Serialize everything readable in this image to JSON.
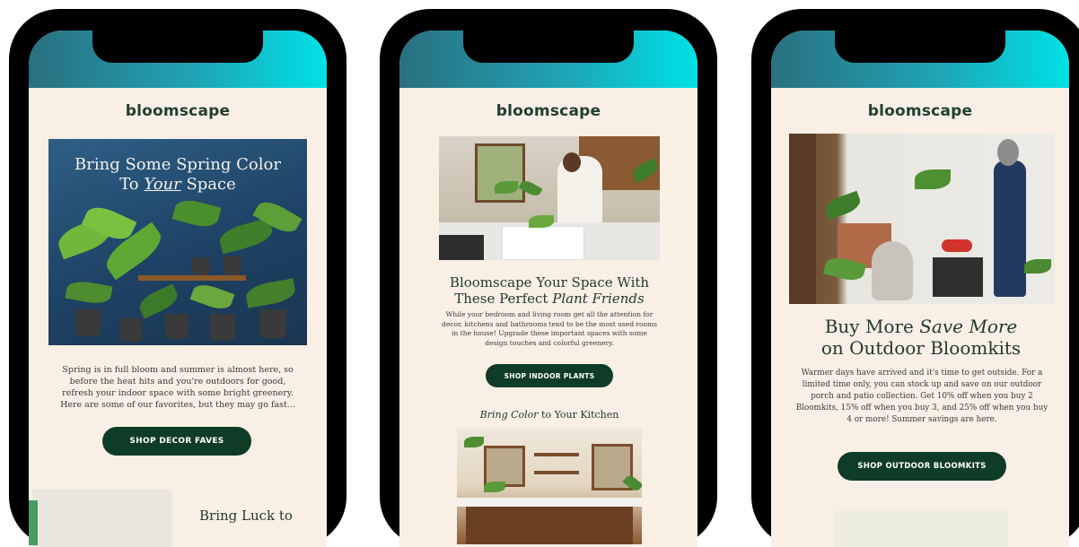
{
  "phone1": {
    "brand": "bloomscape",
    "hero_title_1": "Bring Some Spring Color",
    "hero_title_2a": "To ",
    "hero_title_2b": "Your",
    "hero_title_2c": " Space",
    "body": "Spring is in full bloom and summer is almost here, so before the heat hits and you're outdoors for good, refresh your indoor space with some bright greenery. Here are some of our favorites, but they may go fast...",
    "button": "SHOP DECOR FAVES",
    "next_heading": "Bring Luck to"
  },
  "phone2": {
    "brand": "bloomscape",
    "heading_1": "Bloomscape Your Space With",
    "heading_2a": "These Perfect ",
    "heading_2b": "Plant Friends",
    "body": "While your bedroom and living room get all the attention for decor, kitchens and bathrooms tend to be the most used rooms in the house! Upgrade these important spaces with some design touches and colorful greenery.",
    "button": "SHOP INDOOR PLANTS",
    "sub_a": "Bring Color",
    "sub_b": " to Your Kitchen"
  },
  "phone3": {
    "brand": "bloomscape",
    "heading_1a": "Buy More ",
    "heading_1b": "Save More",
    "heading_2": "on Outdoor Bloomkits",
    "body": "Warmer days have arrived and it's time to get outside. For a limited time only, you can stock up and save on our outdoor porch and patio collection. Get 10% off when you buy 2 Bloomkits, 15% off when you buy 3, and 25% off when you buy 4 or more! Summer savings are here.",
    "button": "SHOP OUTDOOR BLOOMKITS"
  },
  "colors": {
    "brand_green": "#0f3c27",
    "cream": "#f9efe5",
    "gradient_start": "#2a6f7f",
    "gradient_end": "#00e1e6"
  }
}
